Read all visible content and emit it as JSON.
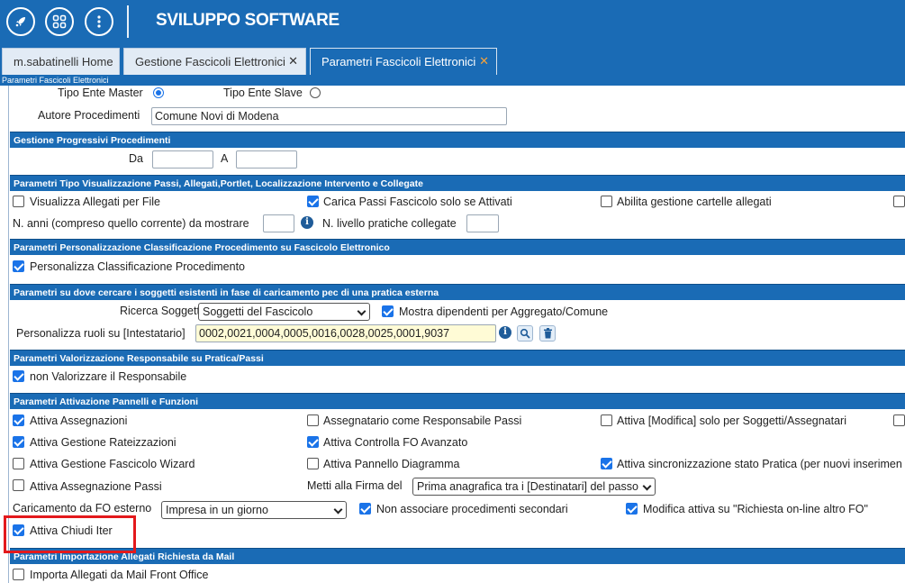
{
  "header": {
    "title": "SVILUPPO SOFTWARE",
    "icons": [
      "rocket-icon",
      "apps-grid-icon",
      "more-vertical-icon"
    ]
  },
  "tabs": [
    {
      "label": "m.sabatinelli Home",
      "closable": false
    },
    {
      "label": "Gestione Fascicoli Elettronici",
      "closable": true
    },
    {
      "label": "Parametri Fascicoli Elettronici",
      "closable": true,
      "active": true
    }
  ],
  "panel_title": "Parametri Fascicoli Elettronici",
  "top": {
    "tipo_master_label": "Tipo Ente Master",
    "tipo_master_selected": true,
    "tipo_slave_label": "Tipo Ente Slave",
    "tipo_slave_selected": false,
    "autore_label": "Autore Procedimenti",
    "autore_value": "Comune Novi di Modena"
  },
  "progressivi": {
    "header": "Gestione Progressivi Procedimenti",
    "da_label": "Da",
    "a_label": "A",
    "da_value": "",
    "a_value": ""
  },
  "visualizzazione": {
    "header": "Parametri Tipo Visualizzazione Passi, Allegati,Portlet, Localizzazione Intervento e Collegate",
    "opt1": {
      "label": "Visualizza Allegati per File",
      "checked": false
    },
    "opt2": {
      "label": "Carica Passi Fascicolo solo se Attivati",
      "checked": true
    },
    "opt3": {
      "label": "Abilita gestione cartelle allegati",
      "checked": false
    },
    "anni_label": "N. anni (compreso quello corrente) da mostrare",
    "anni_value": "",
    "livello_label": "N. livello pratiche collegate",
    "livello_value": ""
  },
  "classificazione": {
    "header": "Parametri Personalizzazione Classificazione Procedimento su Fascicolo Elettronico",
    "opt1": {
      "label": "Personalizza Classificazione Procedimento",
      "checked": true
    }
  },
  "soggetti": {
    "header": "Parametri su dove cercare i soggetti esistenti in fase di caricamento pec di una pratica esterna",
    "ricerca_label": "Ricerca Soggetti",
    "ricerca_value": "Soggetti del Fascicolo",
    "mostra": {
      "label": "Mostra dipendenti per Aggregato/Comune",
      "checked": true
    },
    "ruoli_label": "Personalizza ruoli su [Intestatario]",
    "ruoli_value": "0002,0021,0004,0005,0016,0028,0025,0001,9037"
  },
  "responsabile": {
    "header": "Parametri Valorizzazione Responsabile su Pratica/Passi",
    "opt1": {
      "label": "non Valorizzare il Responsabile",
      "checked": true
    }
  },
  "pannelli": {
    "header": "Parametri Attivazione Pannelli e Funzioni",
    "c1r1": {
      "label": "Attiva Assegnazioni",
      "checked": true
    },
    "c2r1": {
      "label": "Assegnatario come Responsabile Passi",
      "checked": false
    },
    "c3r1": {
      "label": "Attiva [Modifica] solo per Soggetti/Assegnatari",
      "checked": false
    },
    "c1r2": {
      "label": "Attiva Gestione Rateizzazioni",
      "checked": true
    },
    "c2r2": {
      "label": "Attiva Controlla FO Avanzato",
      "checked": true
    },
    "c1r3": {
      "label": "Attiva Gestione Fascicolo Wizard",
      "checked": false
    },
    "c2r3": {
      "label": "Attiva Pannello Diagramma",
      "checked": false
    },
    "c3r3": {
      "label": "Attiva sincronizzazione stato Pratica (per nuovi inserimen",
      "checked": true
    },
    "c1r4": {
      "label": "Attiva Assegnazione Passi",
      "checked": false
    },
    "firma_label": "Metti alla Firma del",
    "firma_value": "Prima anagrafica tra i [Destinatari] del passo",
    "caricamento_label": "Caricamento da FO esterno",
    "caricamento_value": "Impresa in un giorno",
    "nonassociare": {
      "label": "Non associare procedimenti secondari",
      "checked": true
    },
    "modifica": {
      "label": "Modifica attiva su \"Richiesta on-line altro FO\"",
      "checked": true
    },
    "chiudi": {
      "label": "Attiva Chiudi Iter",
      "checked": true
    }
  },
  "importazione": {
    "header": "Parametri Importazione Allegati Richiesta da Mail",
    "opt1": {
      "label": "Importa Allegati da Mail Front Office",
      "checked": false
    }
  },
  "colors": {
    "accent": "#1a6bb5",
    "highlight": "#e3191c",
    "check": "#1a73e8"
  }
}
